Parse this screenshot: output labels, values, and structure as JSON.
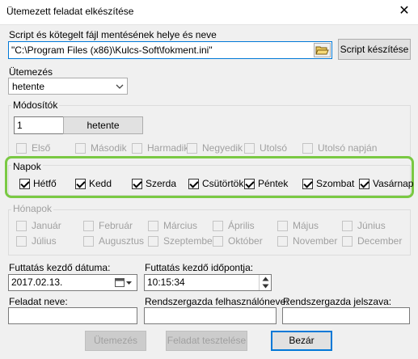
{
  "window": {
    "title": "Ütemezett feladat elkészítése",
    "close_glyph": "✕"
  },
  "script": {
    "label": "Script és kötegelt fájl mentésének helye és neve",
    "path": "\"C:\\Program Files (x86)\\Kulcs-Soft\\fokment.ini\"",
    "make_button": "Script készítése"
  },
  "schedule": {
    "label": "Ütemezés",
    "value": "hetente"
  },
  "modifiers": {
    "label": "Módosítók",
    "count": "1",
    "unit": "hetente",
    "options": [
      "Első",
      "Második",
      "Harmadik",
      "Negyedik",
      "Utolsó",
      "Utolsó napján"
    ]
  },
  "days": {
    "label": "Napok",
    "items": [
      "Hétfő",
      "Kedd",
      "Szerda",
      "Csütörtök",
      "Péntek",
      "Szombat",
      "Vasárnap"
    ],
    "highlight_color": "#7ac943"
  },
  "months": {
    "label": "Hónapok",
    "row1": [
      "Január",
      "Február",
      "Március",
      "Április",
      "Május",
      "Június"
    ],
    "row2": [
      "Július",
      "Augusztus",
      "Szeptember",
      "Október",
      "November",
      "December"
    ]
  },
  "start": {
    "date_label": "Futtatás kezdő dátuma:",
    "date_value": "2017.02.13.",
    "time_label": "Futtatás kezdő időpontja:",
    "time_value": "10:15:34"
  },
  "task": {
    "name_label": "Feladat neve:",
    "admin_user_label": "Rendszergazda felhasználóneve:",
    "admin_pass_label": "Rendszergazda jelszava:"
  },
  "buttons": {
    "schedule": "Ütemezés",
    "test": "Feladat tesztelése",
    "close": "Bezár"
  }
}
